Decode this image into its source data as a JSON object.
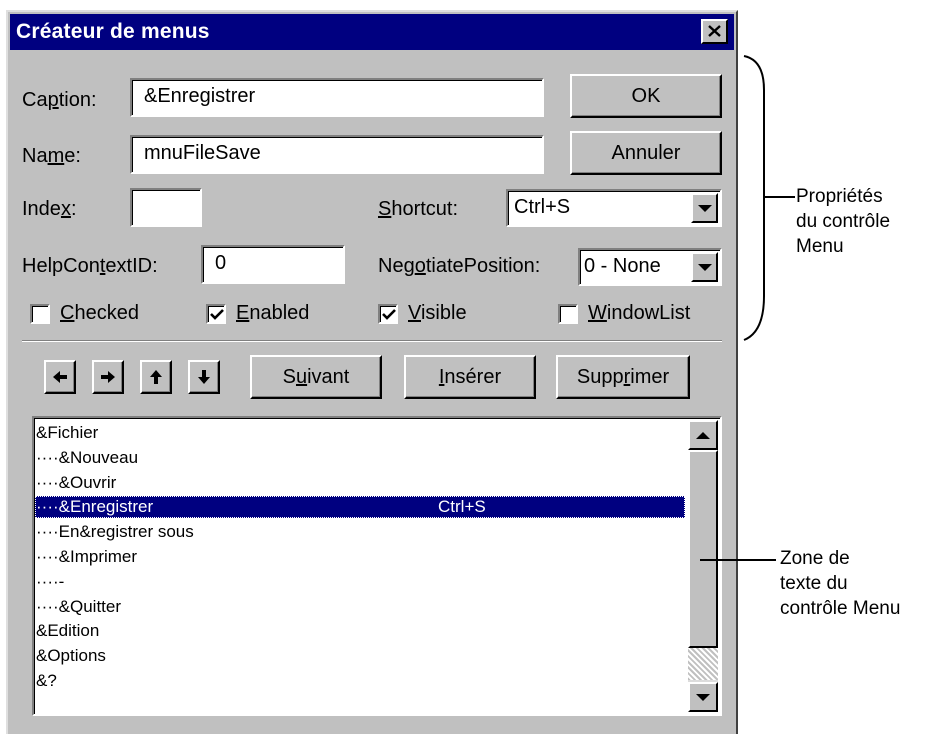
{
  "dialog": {
    "title": "Créateur de menus",
    "close_symbol": "×"
  },
  "fields": {
    "caption": {
      "label_pre": "Ca",
      "label_u": "p",
      "label_post": "tion:",
      "value": "&Enregistrer"
    },
    "name": {
      "label_pre": "Na",
      "label_u": "m",
      "label_post": "e:",
      "value": "mnuFileSave"
    },
    "index": {
      "label_pre": "Inde",
      "label_u": "x",
      "label_post": ":",
      "value": ""
    },
    "shortcut": {
      "label_pre": "",
      "label_u": "S",
      "label_post": "hortcut:",
      "value": "Ctrl+S"
    },
    "helpcontextid": {
      "label_pre": "HelpCon",
      "label_u": "t",
      "label_post": "extID:",
      "value": "0"
    },
    "negotiateposition": {
      "label_pre": "Neg",
      "label_u": "o",
      "label_post": "tiatePosition:",
      "value": "0 - None"
    }
  },
  "checkboxes": [
    {
      "u": "C",
      "rest": "hecked",
      "checked": false
    },
    {
      "u": "E",
      "rest": "nabled",
      "checked": true
    },
    {
      "u": "V",
      "rest": "isible",
      "checked": true
    },
    {
      "u": "W",
      "rest": "indowList",
      "checked": false
    }
  ],
  "buttons": {
    "ok": "OK",
    "cancel": "Annuler",
    "next": {
      "pre": "S",
      "u": "u",
      "post": "ivant"
    },
    "insert": {
      "pre": "",
      "u": "I",
      "post": "nsérer"
    },
    "delete": {
      "pre": "Supp",
      "u": "r",
      "post": "imer"
    }
  },
  "arrow_buttons": [
    "arrow-left-icon",
    "arrow-right-icon",
    "arrow-up-icon",
    "arrow-down-icon"
  ],
  "menu_list": {
    "items": [
      {
        "caption": "&Fichier",
        "shortcut": ""
      },
      {
        "caption": "····&Nouveau",
        "shortcut": ""
      },
      {
        "caption": "····&Ouvrir",
        "shortcut": ""
      },
      {
        "caption": "····&Enregistrer",
        "shortcut": "Ctrl+S",
        "selected": true
      },
      {
        "caption": "····En&registrer sous",
        "shortcut": ""
      },
      {
        "caption": "····&Imprimer",
        "shortcut": ""
      },
      {
        "caption": "····-",
        "shortcut": ""
      },
      {
        "caption": "····&Quitter",
        "shortcut": ""
      },
      {
        "caption": "&Edition",
        "shortcut": ""
      },
      {
        "caption": "&Options",
        "shortcut": ""
      },
      {
        "caption": "&?",
        "shortcut": ""
      }
    ]
  },
  "annotations": {
    "properties": [
      "Propriétés",
      "du contrôle",
      "Menu"
    ],
    "listbox": [
      "Zone de",
      "texte du",
      "contrôle Menu"
    ]
  },
  "colors": {
    "titlebar": "#000080",
    "dialog_face": "#c0c0c0",
    "selection": "#000080"
  }
}
